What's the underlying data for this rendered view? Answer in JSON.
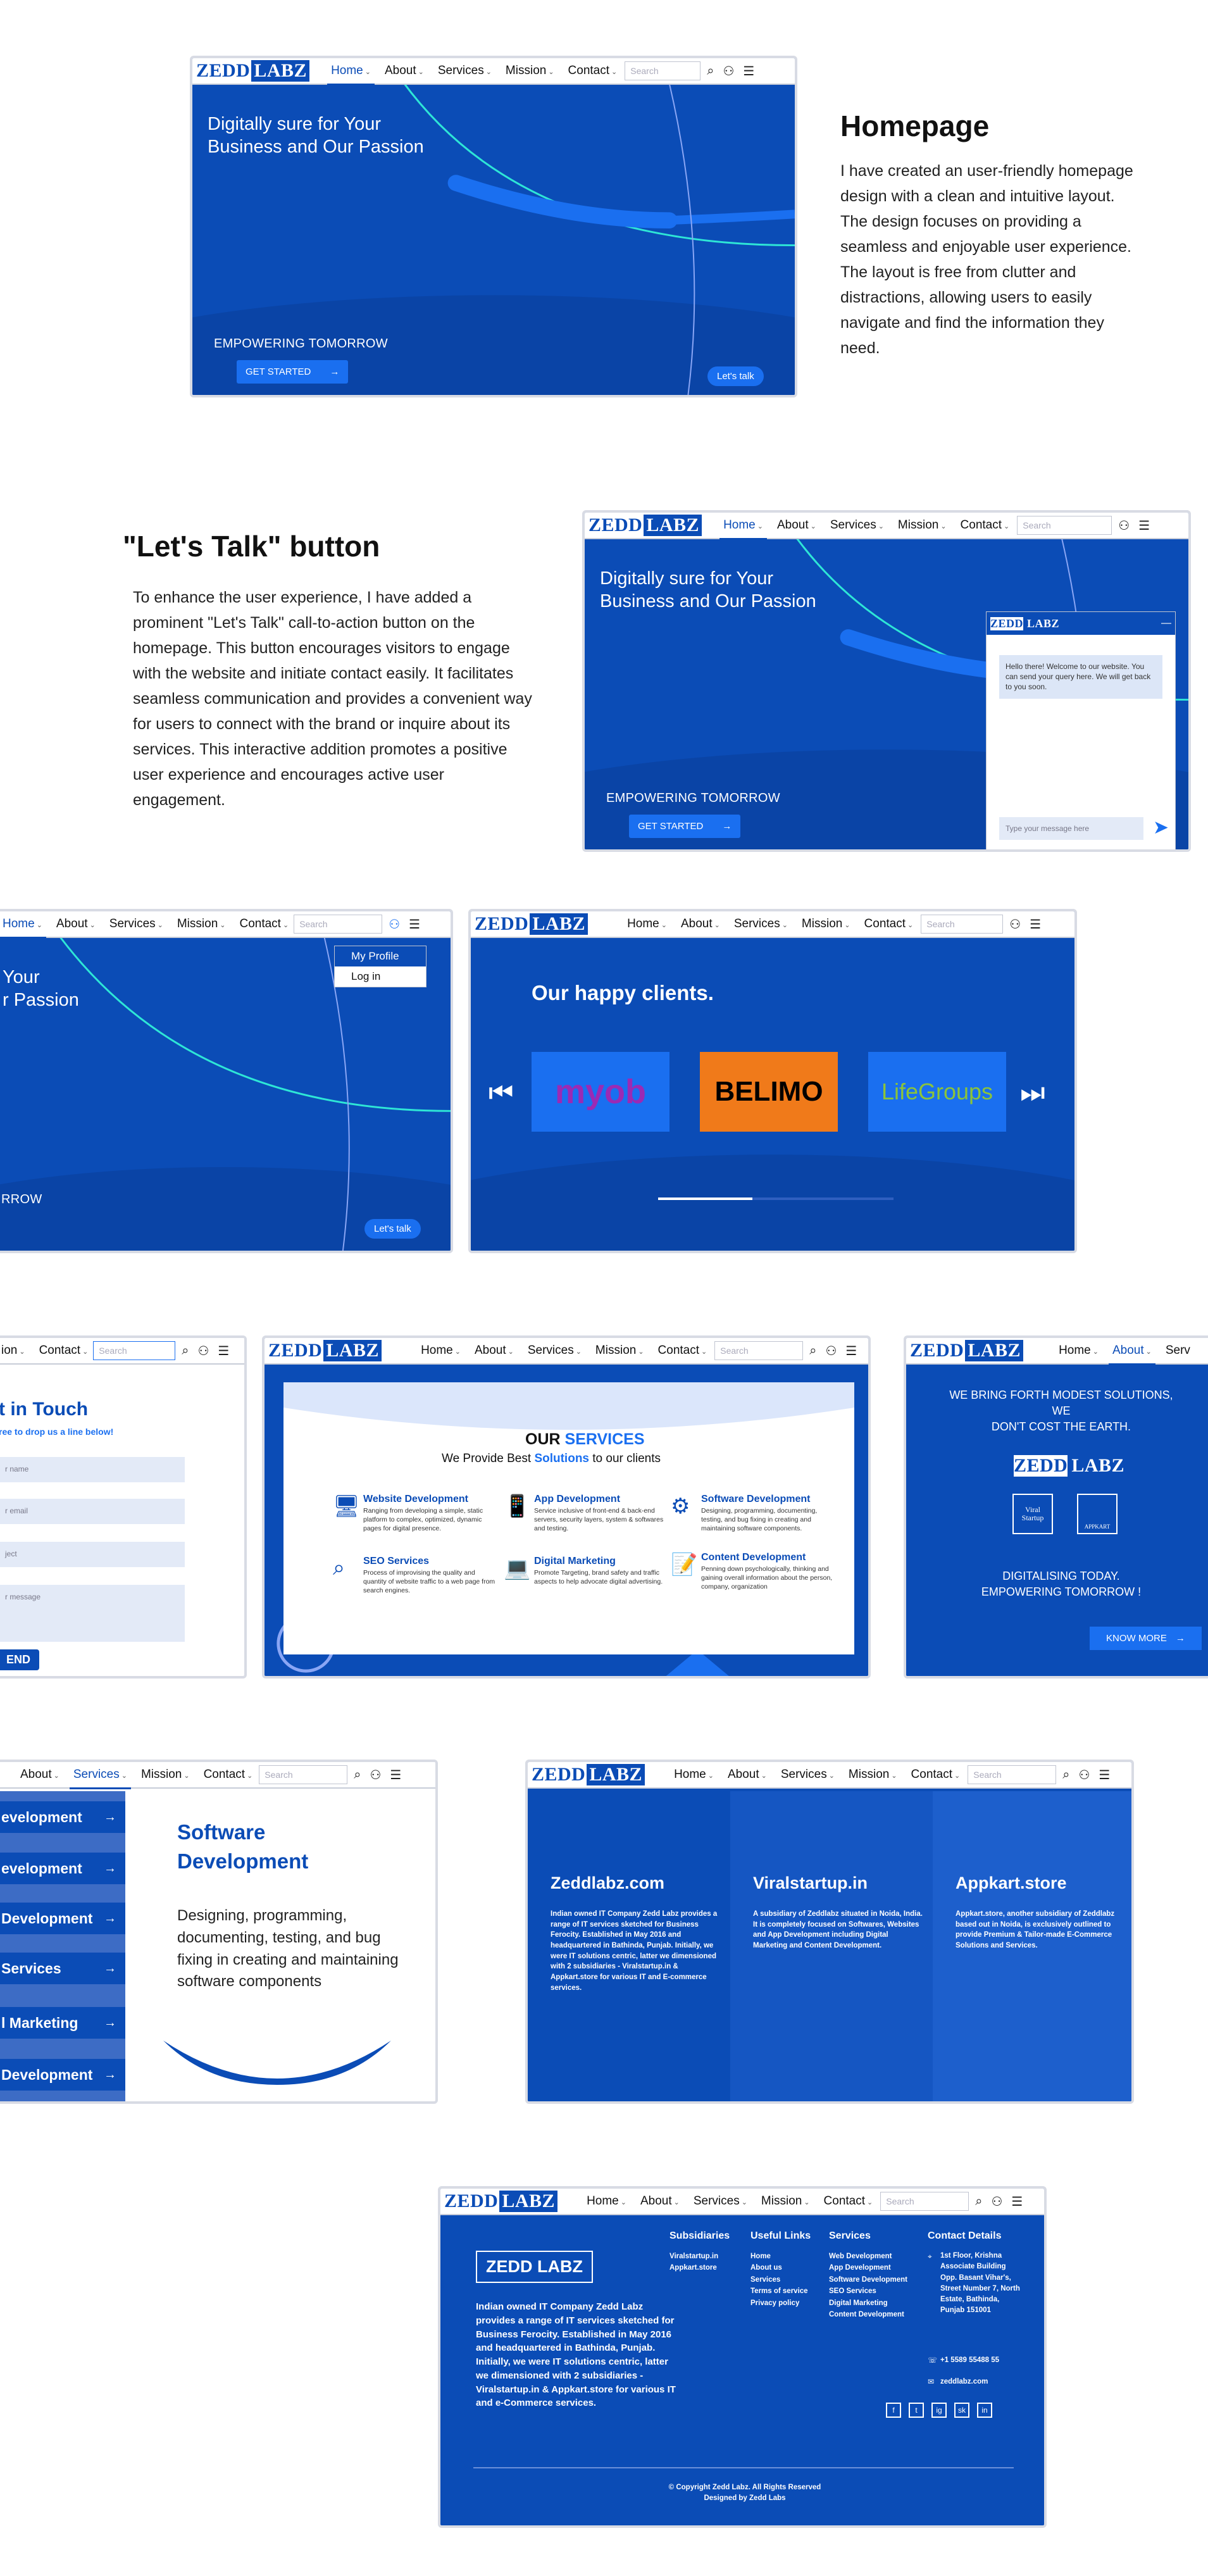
{
  "nav": {
    "logo_left": "ZEDD",
    "logo_right": "LABZ",
    "items": [
      "Home",
      "About",
      "Services",
      "Mission",
      "Contact"
    ],
    "search_placeholder": "Search"
  },
  "hero": {
    "title_line1": "Digitally sure for Your",
    "title_line2": "Business and Our Passion",
    "tagline": "EMPOWERING TOMORROW",
    "cta": "GET STARTED",
    "talk": "Let's talk"
  },
  "homepage_section": {
    "heading": "Homepage",
    "text": "I have created an user-friendly homepage design with a clean and intuitive layout. The design focuses on providing a seamless and enjoyable user experience. The layout is free from clutter and distractions, allowing users to easily navigate and find the information they need."
  },
  "talk_section": {
    "heading": "\"Let's Talk\" button",
    "text": "To enhance the user experience, I have added a prominent \"Let's Talk\" call-to-action button on the homepage. This button encourages visitors to engage with the website and initiate contact easily. It facilitates seamless communication and provides a convenient way for users to connect with the brand or inquire about its services. This interactive addition promotes a positive user experience and encourages active user engagement."
  },
  "chat": {
    "greeting": "Hello there! Welcome to our website. You can send your query here. We will get back to you soon.",
    "placeholder": "Type your message here"
  },
  "profile_menu": {
    "hero_line1": "Your",
    "hero_line2": "r Passion",
    "tagline_fragment": "RROW",
    "items": [
      "My Profile",
      "Log in"
    ]
  },
  "clients": {
    "title": "Our happy clients.",
    "logos": [
      "myob",
      "BELIMO",
      "LifeGroups"
    ]
  },
  "contact_form": {
    "title": "t in Touch",
    "subtitle": "ree to drop us a line below!",
    "fields": [
      "r name",
      "r email",
      "ject",
      "r message"
    ],
    "send": "END",
    "nav_items": [
      "ion",
      "Contact"
    ]
  },
  "services_card": {
    "title_plain": "OUR",
    "title_accent": "SERVICES",
    "subtitle_pre": "We Provide Best",
    "subtitle_accent": "Solutions",
    "subtitle_post": "to our clients",
    "items": [
      {
        "title": "Website Development",
        "desc": "Ranging from developing a simple, static platform to complex, optimized, dynamic pages for digital presence.",
        "icon": "web-icon"
      },
      {
        "title": "App Development",
        "desc": "Service inclusive of front-end & back-end servers, security layers, system & softwares and testing.",
        "icon": "app-icon"
      },
      {
        "title": "Software Development",
        "desc": "Designing, programming, documenting, testing, and bug fixing in creating and maintaining software components.",
        "icon": "software-icon"
      },
      {
        "title": "SEO Services",
        "desc": "Process of improvising the quality and quantity of website traffic to a web page from search engines.",
        "icon": "seo-icon"
      },
      {
        "title": "Digital Marketing",
        "desc": "Promote Targeting, brand safety and traffic aspects to help advocate digital advertising.",
        "icon": "marketing-icon"
      },
      {
        "title": "Content Development",
        "desc": "Penning down psychologically, thinking and gaining overall information about the person, company, organization",
        "icon": "content-icon"
      }
    ]
  },
  "about": {
    "nav_items": [
      "Home",
      "About",
      "Serv"
    ],
    "line1": "WE BRING FORTH MODEST SOLUTIONS, WE",
    "line2": "DON'T COST THE EARTH.",
    "badge1": "Viral Startup",
    "badge2": "APPKART",
    "line3": "DIGITALISING TODAY.",
    "line4": "EMPOWERING TOMORROW !",
    "cta": "KNOW MORE"
  },
  "services_list": {
    "nav_items": [
      "About",
      "Services",
      "Mission",
      "Contact"
    ],
    "items": [
      "evelopment",
      "evelopment",
      "Development",
      "Services",
      "l Marketing",
      "Development"
    ],
    "detail_title": "Software Development",
    "detail_desc": "Designing, programming, documenting, testing, and bug fixing in creating and maintaining software components"
  },
  "subsidiaries": [
    {
      "title": "Zeddlabz.com",
      "text": "Indian owned IT Company Zedd Labz provides a range of IT services sketched for Business Ferocity. Established in May 2016 and headquartered in Bathinda, Punjab. Initially, we were IT solutions centric, latter we dimensioned with 2 subsidiaries - Viralstartup.in & Appkart.store for various IT and E-commerce services."
    },
    {
      "title": "Viralstartup.in",
      "text": "A subsidiary of Zeddlabz situated in Noida, India. It is completely focused on Softwares, Websites and App Development including Digital Marketing and Content Development."
    },
    {
      "title": "Appkart.store",
      "text": "Appkart.store, another subsidiary of Zeddlabz based out in Noida, is exclusively outlined to provide Premium & Tailor-made E-Commerce Solutions and Services."
    }
  ],
  "footer": {
    "logo": "ZEDD LABZ",
    "desc": "Indian owned IT Company Zedd Labz provides a range of IT services sketched for Business Ferocity. Established in May 2016 and headquartered in Bathinda, Punjab. Initially, we were IT solutions centric, latter we dimensioned with 2 subsidiaries - Viralstartup.in & Appkart.store for various IT and e-Commerce services.",
    "subsidiaries_title": "Subsidiaries",
    "subsidiaries": [
      "Viralstartup.in",
      "Appkart.store"
    ],
    "links_title": "Useful Links",
    "links": [
      "Home",
      "About us",
      "Services",
      "Terms of service",
      "Privacy policy"
    ],
    "services_title": "Services",
    "services": [
      "Web Development",
      "App Development",
      "Software Development",
      "SEO Services",
      "Digital Marketing",
      "Content Development"
    ],
    "contact_title": "Contact Details",
    "address": "1st Floor, Krishna Associate Building Opp. Basant Vihar's, Street Number 7, North Estate, Bathinda, Punjab 151001",
    "phone": "+1 5589 55488 55",
    "email": "zeddlabz.com",
    "socials": [
      "f",
      "t",
      "ig",
      "sk",
      "in"
    ],
    "copyright": "© Copyright Zedd Labz. All Rights Reserved",
    "designed": "Designed by  Zedd Labs"
  }
}
